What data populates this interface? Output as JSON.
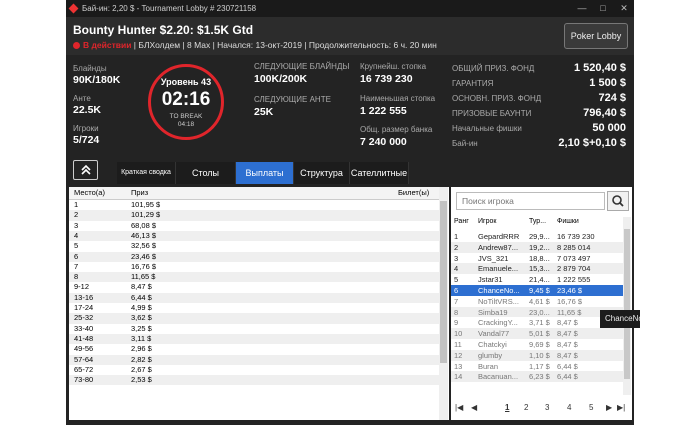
{
  "window": {
    "title": "Бай-ин: 2,20 $ - Tournament Lobby # 230721158",
    "controls": [
      "—",
      "□",
      "✕"
    ]
  },
  "header": {
    "name": "Bounty Hunter $2.20: $1.5K Gtd",
    "status": "В действии",
    "info": "| БЛХолдем | 8 Max | Начался: 13-окт-2019 | Продолжительность: 6 ч. 20 мин",
    "lobby_button": "Poker Lobby"
  },
  "stats": {
    "blinds_label": "Блайнды",
    "blinds_value": "90K/180K",
    "ante_label": "Анте",
    "ante_value": "22.5K",
    "players_label": "Игроки",
    "players_value": "5/724",
    "level": "Уровень 43",
    "timer": "02:16",
    "to_break_label": "TO BREAK",
    "to_break_time": "04:18",
    "next_blinds_label": "СЛЕДУЮЩИЕ БЛАЙНДЫ",
    "next_blinds_value": "100K/200K",
    "next_ante_label": "СЛЕДУЮЩИЕ АНТЕ",
    "next_ante_value": "25K",
    "largest_stack_label": "Крупнейш. стопка",
    "largest_stack_value": "16 739 230",
    "smallest_stack_label": "Наименьшая стопка",
    "smallest_stack_value": "1 222 555",
    "total_bank_label": "Общ. размер банка",
    "total_bank_value": "7 240 000",
    "prize_pool_label": "ОБЩИЙ ПРИЗ. ФОНД",
    "prize_pool_value": "1 520,40 $",
    "guarantee_label": "ГАРАНТИЯ",
    "guarantee_value": "1 500 $",
    "main_pool_label": "ОСНОВН. ПРИЗ. ФОНД",
    "main_pool_value": "724 $",
    "bounty_label": "ПРИЗОВЫЕ БАУНТИ",
    "bounty_value": "796,40 $",
    "start_chips_label": "Начальные фишки",
    "start_chips_value": "50 000",
    "buyin_label": "Бай-ин",
    "buyin_value": "2,10 $+0,10 $"
  },
  "expand_icon": "double-chevron-up-icon",
  "tabs": [
    {
      "label": "Краткая сводка",
      "active": false
    },
    {
      "label": "Столы",
      "active": false
    },
    {
      "label": "Выплаты",
      "active": true
    },
    {
      "label": "Структура",
      "active": false
    },
    {
      "label": "Сателлитные",
      "active": false
    }
  ],
  "payouts": {
    "col_place": "Место(а)",
    "col_prize": "Приз",
    "col_ticket": "Билет(ы)",
    "rows": [
      {
        "place": "1",
        "prize": "101,95 $"
      },
      {
        "place": "2",
        "prize": "101,29 $"
      },
      {
        "place": "3",
        "prize": "68,08 $"
      },
      {
        "place": "4",
        "prize": "46,13 $"
      },
      {
        "place": "5",
        "prize": "32,56 $"
      },
      {
        "place": "6",
        "prize": "23,46 $"
      },
      {
        "place": "7",
        "prize": "16,76 $"
      },
      {
        "place": "8",
        "prize": "11,65 $"
      },
      {
        "place": "9-12",
        "prize": "8,47 $"
      },
      {
        "place": "13-16",
        "prize": "6,44 $"
      },
      {
        "place": "17-24",
        "prize": "4,99 $"
      },
      {
        "place": "25-32",
        "prize": "3,62 $"
      },
      {
        "place": "33-40",
        "prize": "3,25 $"
      },
      {
        "place": "41-48",
        "prize": "3,11 $"
      },
      {
        "place": "49-56",
        "prize": "2,96 $"
      },
      {
        "place": "57-64",
        "prize": "2,82 $"
      },
      {
        "place": "65-72",
        "prize": "2,67 $"
      },
      {
        "place": "73-80",
        "prize": "2,53 $"
      }
    ]
  },
  "players": {
    "search_placeholder": "Поиск игрока",
    "col_rank": "Ранг",
    "col_player": "Игрок",
    "col_tour": "Тур...",
    "col_chips": "Фишки",
    "rows": [
      {
        "rank": "1",
        "player": "GepardRRR",
        "tour": "29,9...",
        "chips": "16 739 230"
      },
      {
        "rank": "2",
        "player": "Andrew87...",
        "tour": "19,2...",
        "chips": "8 285 014"
      },
      {
        "rank": "3",
        "player": "JVS_321",
        "tour": "18,8...",
        "chips": "7 073 497"
      },
      {
        "rank": "4",
        "player": "Emanuele...",
        "tour": "15,3...",
        "chips": "2 879 704"
      },
      {
        "rank": "5",
        "player": "Jstar31",
        "tour": "21,4...",
        "chips": "1 222 555"
      },
      {
        "rank": "6",
        "player": "ChanceNo...",
        "tour": "9,45 $",
        "chips": "23,46 $"
      },
      {
        "rank": "7",
        "player": "NoTiltVRS...",
        "tour": "4,61 $",
        "chips": "16,76 $"
      },
      {
        "rank": "8",
        "player": "Simba19",
        "tour": "23,0...",
        "chips": "11,65 $"
      },
      {
        "rank": "9",
        "player": "CrackingY...",
        "tour": "3,71 $",
        "chips": "8,47 $"
      },
      {
        "rank": "10",
        "player": "Vandal77",
        "tour": "5,01 $",
        "chips": "8,47 $"
      },
      {
        "rank": "11",
        "player": "Chatckyi",
        "tour": "9,69 $",
        "chips": "8,47 $"
      },
      {
        "rank": "12",
        "player": "glumby",
        "tour": "1,10 $",
        "chips": "8,47 $"
      },
      {
        "rank": "13",
        "player": "Buran",
        "tour": "1,17 $",
        "chips": "6,44 $"
      },
      {
        "rank": "14",
        "player": "Bacanuan...",
        "tour": "6,23 $",
        "chips": "6,44 $"
      }
    ],
    "pager": {
      "first": "|◀",
      "prev": "◀",
      "pages": [
        "1",
        "2",
        "3",
        "4",
        "5"
      ],
      "next": "▶",
      "last": "▶|"
    }
  },
  "tooltip": "ChanceNo"
}
